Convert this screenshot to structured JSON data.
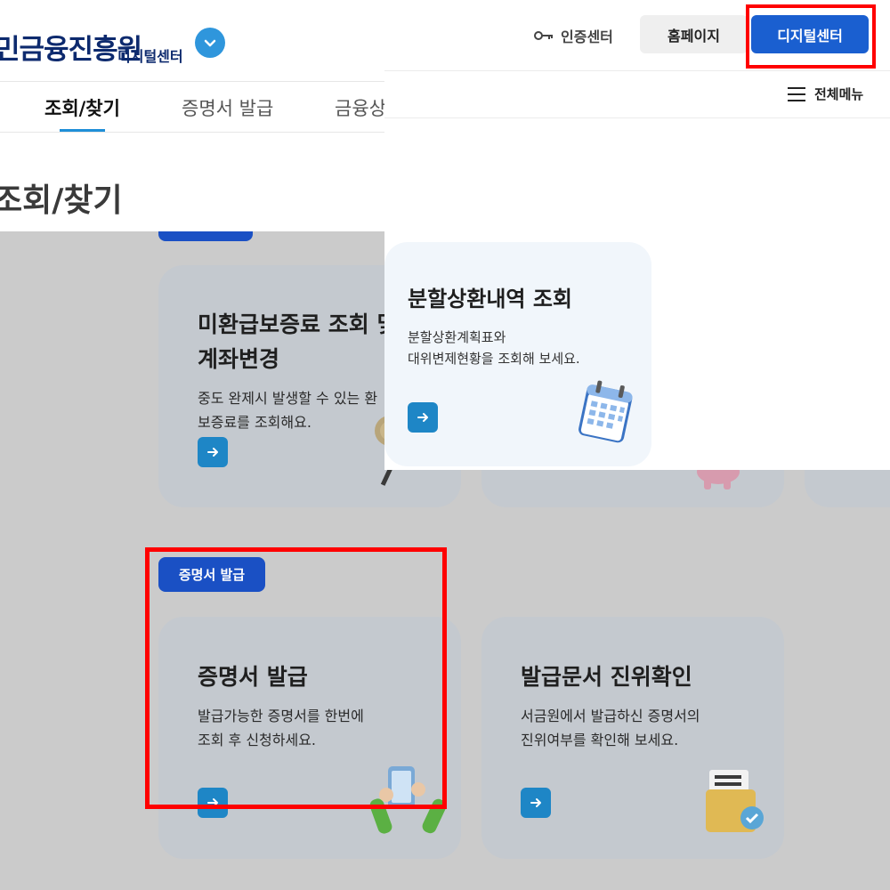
{
  "header": {
    "logo_text": "민금융진흥원",
    "logo_sub": "디지털센터",
    "nav": [
      "조회/찾기",
      "증명서 발급",
      "금융상"
    ],
    "page_title": "조회/찾기",
    "cert_center_label": "인증센터",
    "homepage_label": "홈페이지",
    "digital_center_label": "디지털센터",
    "all_menu_label": "전체메뉴"
  },
  "cards": {
    "installment": {
      "title": "분할상환내역 조회",
      "desc_line1": "분할상환계획표와",
      "desc_line2": "대위변제현황을 조회해 보세요."
    },
    "unrefunded": {
      "title_line1": "미환급보증료 조회 및",
      "title_line2": "계좌변경",
      "desc_line1": "중도 완제시 발생할 수 있는 환",
      "desc_line2": "보증료를 조회해요."
    },
    "cert_section_badge": "증명서 발급",
    "cert_issue": {
      "title": "증명서 발급",
      "desc_line1": "발급가능한 증명서를 한번에",
      "desc_line2": "조회 후 신청하세요."
    },
    "doc_verify": {
      "title": "발급문서 진위확인",
      "desc_line1": "서금원에서 발급하신 증명서의",
      "desc_line2": "진위여부를 확인해 보세요."
    }
  },
  "colors": {
    "primary": "#1a5fd0",
    "arrow_button": "#1e86c6",
    "badge": "#1a50c4",
    "highlight": "#ff0000",
    "overlay_bg": "#cbcbcb"
  },
  "icons": [
    "chevron-down-icon",
    "key-icon",
    "hamburger-icon",
    "arrow-right-icon",
    "calendar-icon",
    "phone-hands-icon",
    "folder-check-icon",
    "piggy-bank-icon",
    "coin-magnifier-icon"
  ]
}
